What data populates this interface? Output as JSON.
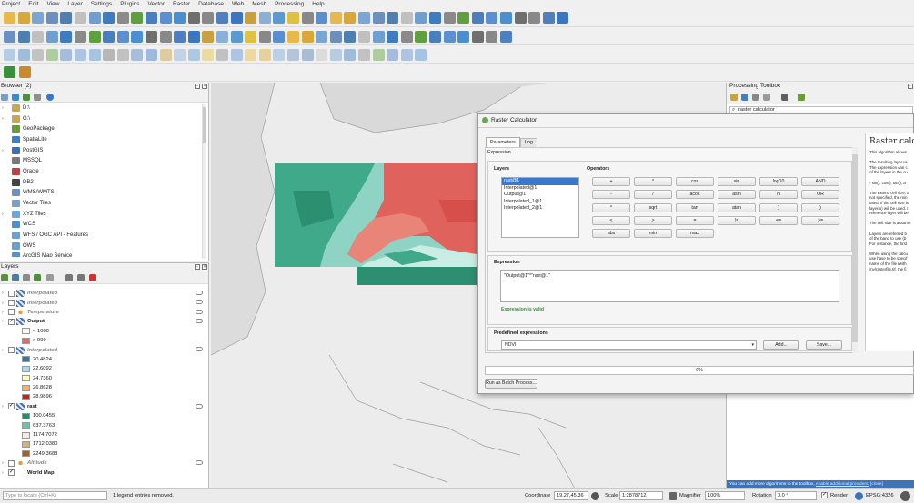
{
  "menu": [
    "Project",
    "Edit",
    "View",
    "Layer",
    "Settings",
    "Plugins",
    "Vector",
    "Raster",
    "Database",
    "Web",
    "Mesh",
    "Processing",
    "Help"
  ],
  "browser": {
    "title": "Browser (2)",
    "items": [
      "D:\\",
      "G:\\",
      "GeoPackage",
      "SpatiaLite",
      "PostGIS",
      "MSSQL",
      "Oracle",
      "DB2",
      "WMS/WMTS",
      "Vector Tiles",
      "XYZ Tiles",
      "WCS",
      "WFS / OGC API - Features",
      "OWS",
      "ArcGIS Map Service"
    ]
  },
  "layers": {
    "title": "Layers",
    "rows": [
      {
        "label": "Interpolated",
        "style": "italic"
      },
      {
        "label": "Interpolated",
        "style": "italic"
      },
      {
        "label": "Temperature",
        "style": "italic"
      },
      {
        "label": "Output",
        "style": "bold"
      },
      {
        "label": "< 1000",
        "style": "legend",
        "color": "#ffffff"
      },
      {
        "label": "> 999",
        "style": "legend",
        "color": "#e56a62"
      },
      {
        "label": "Interpolated",
        "style": "italic"
      },
      {
        "label": "20.4824",
        "style": "legend",
        "color": "#2c7bb6"
      },
      {
        "label": "22.6092",
        "style": "legend",
        "color": "#abd9e9"
      },
      {
        "label": "24.7360",
        "style": "legend",
        "color": "#ffffbf"
      },
      {
        "label": "26.8628",
        "style": "legend",
        "color": "#fdae61"
      },
      {
        "label": "28.9896",
        "style": "legend",
        "color": "#d7191c"
      },
      {
        "label": "rast",
        "style": "bold"
      },
      {
        "label": "100.0455",
        "style": "legend",
        "color": "#1a9370"
      },
      {
        "label": "637.3763",
        "style": "legend",
        "color": "#74c2a6"
      },
      {
        "label": "1174.7072",
        "style": "legend",
        "color": "#f1efd8"
      },
      {
        "label": "1712.0380",
        "style": "legend",
        "color": "#d8b26b"
      },
      {
        "label": "2249.3688",
        "style": "legend",
        "color": "#a6611a"
      },
      {
        "label": "Altitude",
        "style": "italic"
      },
      {
        "label": "World Map",
        "style": "bold"
      }
    ]
  },
  "toolbox": {
    "title": "Processing Toolbox",
    "search": "raster calculator",
    "footer": "You can add more algorithms to the toolbox,",
    "footer_link": "enable additional providers.",
    "footer_close": "[close]"
  },
  "dialog": {
    "title": "Raster Calculator",
    "tabs": [
      "Parameters",
      "Log"
    ],
    "expression_header": "Expression",
    "layers_label": "Layers",
    "operators_label": "Operators",
    "layers": [
      "rast@1",
      "Interpolated@1",
      "Output@1",
      "Interpolated_1@1",
      "Interpolated_2@1"
    ],
    "operators": [
      "+",
      "*",
      "cos",
      "sin",
      "log10",
      "AND",
      "-",
      "/",
      "acos",
      "asin",
      "ln",
      "OR",
      "^",
      "sqrt",
      "tan",
      "atan",
      "(",
      ")",
      "<",
      ">",
      "=",
      "!=",
      "<=",
      ">=",
      "abs",
      "min",
      "max"
    ],
    "expression_label": "Expression",
    "expression": "\"Output@1\"*\"rast@1\"",
    "valid": "Expression is valid",
    "predefined_label": "Predefined expressions",
    "predefined": "NDVI",
    "add": "Add...",
    "save": "Save...",
    "progress": "0%",
    "batch": "Run as Batch Process...",
    "help_title": "Raster calcu",
    "help_lines": [
      "This algorithm allows",
      "",
      "The resulting layer wi",
      "The expression can c",
      "of the layers in the cu",
      "",
      "- sin(), cos(), tan(), a",
      "",
      "The extent, cell size, a",
      "not specified, the min",
      "used. If the cell size is",
      "layer(s) will be used. I",
      "reference layer will be",
      "",
      "The cell size is assume",
      "",
      "Layers are referred b",
      "of the band to use (b",
      "For instance, the first",
      "",
      "When using the calcu",
      "use have to be specif",
      "name of the file (with",
      "my/rasterfile.tif, the fi"
    ]
  },
  "status": {
    "locate_placeholder": "Type to locate (Ctrl+K)",
    "message": "1 legend entries removed.",
    "coordinate_label": "Coordinate",
    "coordinate": "19.27,45.36",
    "scale_label": "Scale",
    "scale": "1:2878712",
    "magnifier_label": "Magnifier",
    "magnifier": "100%",
    "rotation_label": "Rotation",
    "rotation": "0.0 °",
    "render_label": "Render",
    "crs": "EPSG:4326"
  }
}
